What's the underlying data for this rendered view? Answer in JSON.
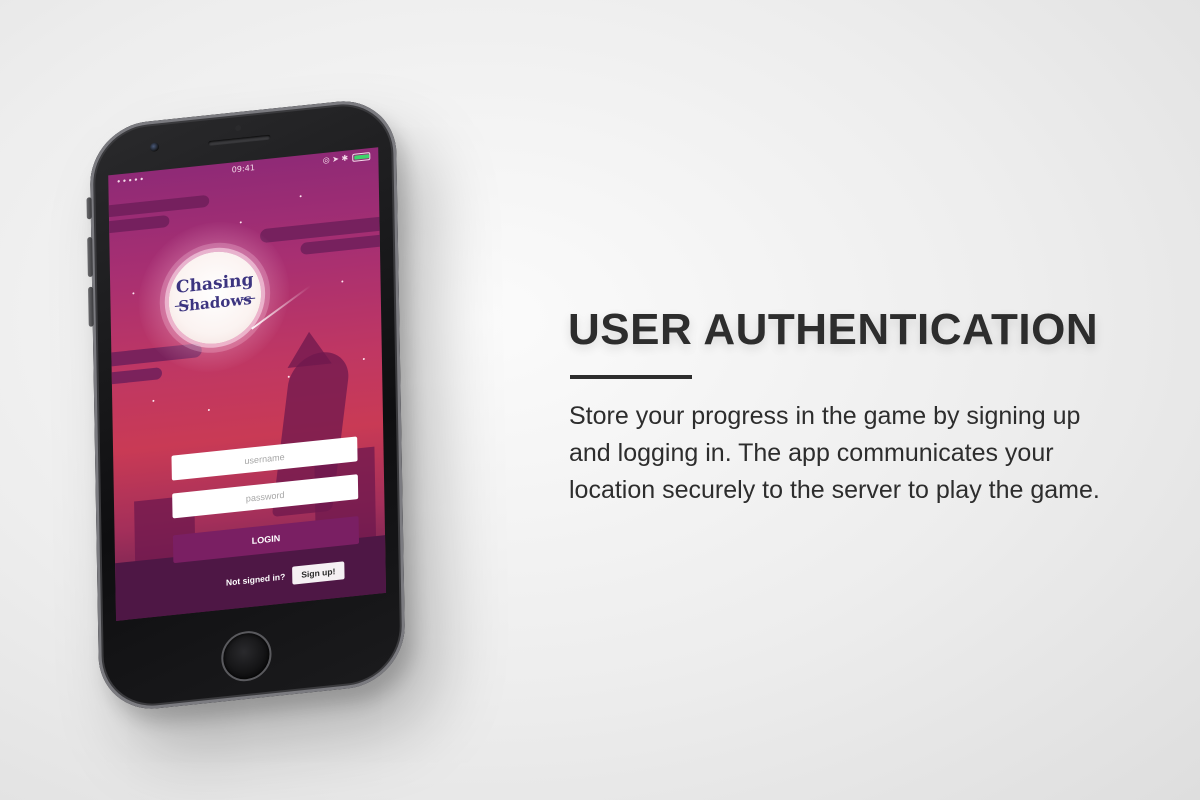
{
  "app": {
    "logo_line1": "Chasing",
    "logo_line2": "Shadows"
  },
  "status_bar": {
    "time": "09:41",
    "signal": "•••••",
    "icons": "◎ ➤ ✱",
    "battery_level": 0.95
  },
  "login_form": {
    "username_placeholder": "username",
    "password_placeholder": "password",
    "login_label": "LOGIN",
    "not_signed_in_label": "Not signed in?",
    "signup_label": "Sign up!"
  },
  "feature": {
    "title": "USER AUTHENTICATION",
    "description": "Store your progress in the game by signing up and logging in. The app communicates your location securely to the server to play the game."
  },
  "colors": {
    "screen_top": "#8f2a76",
    "screen_mid": "#c93a55",
    "login_button": "#7a1f63",
    "logo_text": "#3c3480",
    "heading_text": "#2d2d2d"
  }
}
